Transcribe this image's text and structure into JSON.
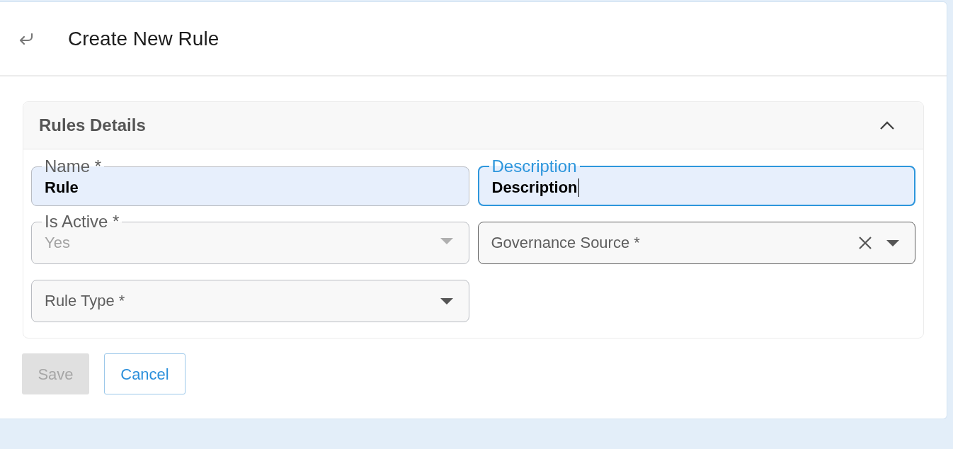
{
  "header": {
    "title": "Create New Rule"
  },
  "panel": {
    "title": "Rules Details",
    "expanded": true,
    "fields": [
      {
        "kind": "text",
        "label": "Name *",
        "value": "Rule",
        "autofilled": true,
        "focused": false,
        "disabled": false,
        "hovered": false
      },
      {
        "kind": "text",
        "label": "Description",
        "value": "Description",
        "autofilled": true,
        "focused": true,
        "disabled": false,
        "hovered": false
      },
      {
        "kind": "select",
        "label": "Is Active *",
        "value": "Yes",
        "autofilled": false,
        "focused": false,
        "disabled": true,
        "clearable": false,
        "hovered": false
      },
      {
        "kind": "select",
        "label": "Governance Source *",
        "autofilled": false,
        "focused": false,
        "disabled": false,
        "clearable": true,
        "hovered": true
      },
      {
        "kind": "select",
        "label": "Rule Type *",
        "autofilled": false,
        "focused": false,
        "disabled": false,
        "clearable": false,
        "hovered": false
      }
    ]
  },
  "buttons": [
    {
      "kind": "primary",
      "label": "Save",
      "disabled": true
    },
    {
      "kind": "outline",
      "label": "Cancel",
      "disabled": false
    }
  ]
}
